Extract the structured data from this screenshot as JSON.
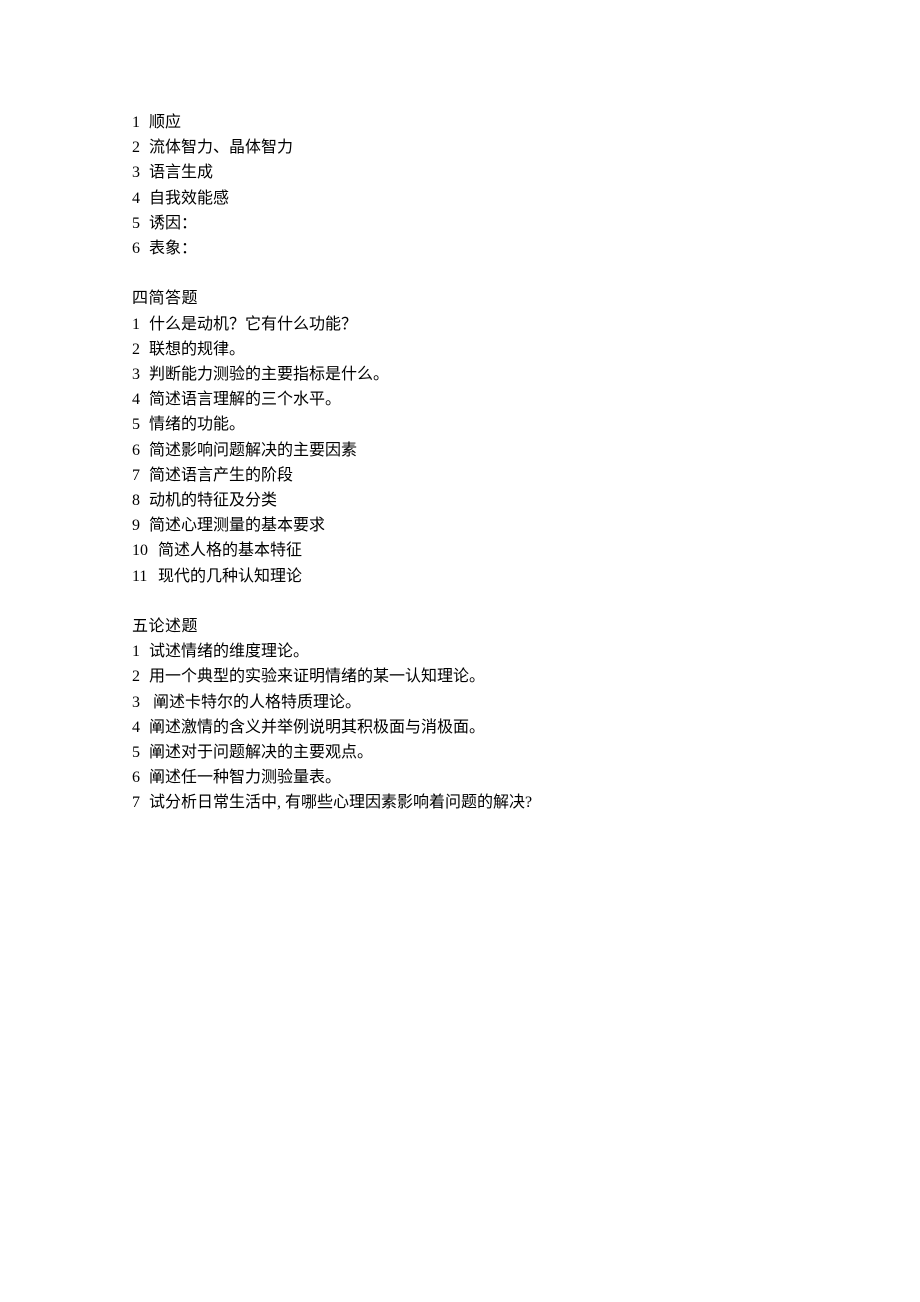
{
  "section1": {
    "items": [
      {
        "num": "1",
        "text": "顺应"
      },
      {
        "num": "2",
        "text": "流体智力、晶体智力"
      },
      {
        "num": "3",
        "text": "语言生成"
      },
      {
        "num": "4",
        "text": "自我效能感"
      },
      {
        "num": "5",
        "text": "诱因："
      },
      {
        "num": "6",
        "text": "表象："
      }
    ]
  },
  "section2": {
    "header_num": "四",
    "header_text": "简答题",
    "items": [
      {
        "num": "1",
        "text": "什么是动机？它有什么功能？"
      },
      {
        "num": "2",
        "text": "联想的规律。"
      },
      {
        "num": "3",
        "text": "判断能力测验的主要指标是什么。"
      },
      {
        "num": "4",
        "text": "简述语言理解的三个水平。"
      },
      {
        "num": "5",
        "text": "情绪的功能。"
      },
      {
        "num": "6",
        "text": "简述影响问题解决的主要因素"
      },
      {
        "num": "7",
        "text": "简述语言产生的阶段"
      },
      {
        "num": "8",
        "text": "动机的特征及分类"
      },
      {
        "num": "9",
        "text": "简述心理测量的基本要求"
      },
      {
        "num": "10",
        "text": "简述人格的基本特征"
      },
      {
        "num": "11",
        "text": "现代的几种认知理论"
      }
    ]
  },
  "section3": {
    "header_num": "五",
    "header_text": "论述题",
    "items": [
      {
        "num": "1",
        "text": "试述情绪的维度理论。"
      },
      {
        "num": "2",
        "text": "用一个典型的实验来证明情绪的某一认知理论。"
      },
      {
        "num": "3",
        "text": " 阐述卡特尔的人格特质理论。"
      },
      {
        "num": "4",
        "text": "阐述激情的含义并举例说明其积极面与消极面。"
      },
      {
        "num": "5",
        "text": "阐述对于问题解决的主要观点。"
      },
      {
        "num": "6",
        "text": "阐述任一种智力测验量表。"
      },
      {
        "num": "7",
        "text": "试分析日常生活中, 有哪些心理因素影响着问题的解决?"
      }
    ]
  }
}
